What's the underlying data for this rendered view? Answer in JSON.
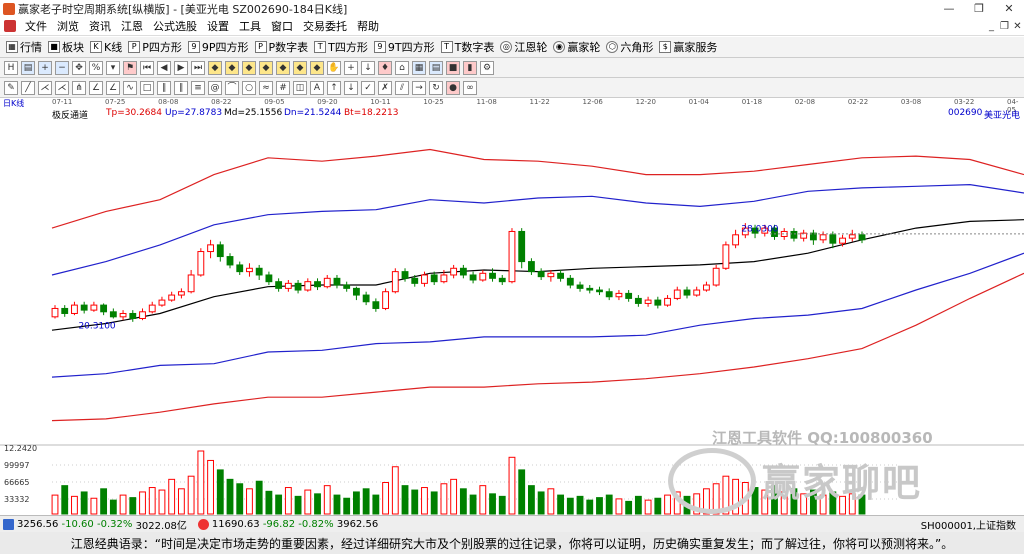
{
  "window": {
    "title": "赢家老子时空周期系统[纵横版] - [美亚光电  SZ002690-184日K线]",
    "controls": [
      "—",
      "❐",
      "✕"
    ]
  },
  "menu": {
    "items": [
      "文件",
      "浏览",
      "资讯",
      "江恩",
      "公式选股",
      "设置",
      "工具",
      "窗口",
      "交易委托",
      "帮助"
    ],
    "right_controls": [
      "_",
      "❐",
      "✕"
    ]
  },
  "toolbar": {
    "items": [
      {
        "label": "行情",
        "icon": "grid-icon"
      },
      {
        "label": "板块",
        "icon": "blocks-icon"
      },
      {
        "label": "K线",
        "icon": "candle-icon"
      },
      {
        "label": "P四方形",
        "icon": "p-square-icon"
      },
      {
        "label": "9P四方形",
        "icon": "9p-square-icon"
      },
      {
        "label": "P数字表",
        "icon": "p-table-icon"
      },
      {
        "label": "T四方形",
        "icon": "t-square-icon"
      },
      {
        "label": "9T四方形",
        "icon": "9t-square-icon"
      },
      {
        "label": "T数字表",
        "icon": "t-table-icon"
      },
      {
        "label": "江恩轮",
        "icon": "gann-wheel-icon"
      },
      {
        "label": "赢家轮",
        "icon": "winner-wheel-icon"
      },
      {
        "label": "六角形",
        "icon": "hexagon-icon"
      },
      {
        "label": "赢家服务",
        "icon": "service-icon"
      }
    ]
  },
  "chart_header": {
    "period": "日K线",
    "indicator_name": "极反通道",
    "tp": "Tp=30.2684",
    "up": "Up=27.8783",
    "md": "Md=25.1556",
    "dn": "Dn=21.5244",
    "bt": "Bt=18.2213",
    "stock_code": "002690",
    "stock_name": "美亚光电"
  },
  "date_ticks": [
    "07-11",
    "07-25",
    "08-08",
    "08-22",
    "09-05",
    "09-20",
    "10-11",
    "10-25",
    "11-08",
    "11-22",
    "12-06",
    "12-20",
    "01-04",
    "01-18",
    "02-08",
    "02-22",
    "03-08",
    "03-22",
    "04-05"
  ],
  "price_labels": {
    "low": "20.3100",
    "high": "28.0300"
  },
  "volume_axis": [
    "12.2420",
    "99997",
    "66665",
    "33332"
  ],
  "watermark": {
    "line1": "江恩工具软件  QQ:100800360",
    "line2": "赢家聊吧"
  },
  "status": {
    "sh": {
      "value": "3256.56",
      "change": "-10.60",
      "pct": "-0.32%",
      "amount": "3022.08亿"
    },
    "sz": {
      "value": "11690.63",
      "change": "-96.82",
      "pct": "-0.82%",
      "amount": "3962.56"
    },
    "right": "SH000001,上证指数"
  },
  "quote": "江恩经典语录：“时间是决定市场走势的重要因素，经过详细研究大市及个别股票的过往记录，你将可以证明，历史确实重复发生；而了解过往，你将可以预测将来。”。",
  "colors": {
    "up": "#ff0000",
    "down": "#008000",
    "red_band": "#dd2222",
    "blue_band": "#2222cc",
    "mid_line": "#000000"
  },
  "chart_data": {
    "type": "line",
    "title": "",
    "xlabel": "",
    "ylabel": "",
    "x": [
      "07-11",
      "07-25",
      "08-08",
      "08-22",
      "09-05",
      "09-20",
      "10-11",
      "10-25",
      "11-08",
      "11-22",
      "12-06",
      "12-20",
      "01-04",
      "01-18",
      "02-08",
      "02-22",
      "03-08",
      "03-22",
      "04-05"
    ],
    "ylim": [
      13.0,
      32.0
    ],
    "series": [
      {
        "name": "Tp",
        "values": [
          25.6,
          26.6,
          27.3,
          28.8,
          29.8,
          29.6,
          29.9,
          30.3,
          29.7,
          29.6,
          29.3,
          28.8,
          28.8,
          29.0,
          29.4,
          29.8,
          29.9,
          29.7,
          28.8
        ]
      },
      {
        "name": "Up",
        "values": [
          22.8,
          23.6,
          24.6,
          25.8,
          26.4,
          26.6,
          26.7,
          27.3,
          27.1,
          27.4,
          27.5,
          27.1,
          26.9,
          27.2,
          27.8,
          28.0,
          28.1,
          28.2,
          27.7
        ]
      },
      {
        "name": "Md",
        "values": [
          19.5,
          19.9,
          20.5,
          21.5,
          22.1,
          22.2,
          22.2,
          22.9,
          23.1,
          23.0,
          23.2,
          23.3,
          23.4,
          23.6,
          24.1,
          24.9,
          25.6,
          26.0,
          26.1
        ]
      },
      {
        "name": "Dn",
        "values": [
          16.7,
          16.9,
          17.4,
          17.5,
          18.2,
          18.3,
          18.7,
          18.8,
          19.1,
          19.1,
          19.1,
          19.2,
          19.8,
          20.2,
          20.4,
          20.8,
          21.9,
          22.9,
          24.1
        ]
      },
      {
        "name": "Bt",
        "values": [
          14.1,
          14.2,
          14.6,
          15.1,
          15.5,
          15.5,
          15.8,
          16.1,
          16.1,
          16.3,
          16.4,
          16.6,
          16.9,
          17.3,
          17.8,
          18.4,
          19.8,
          21.4,
          22.9
        ]
      }
    ],
    "candles": [
      [
        20.3,
        20.8,
        20.2,
        21.0
      ],
      [
        20.8,
        20.5,
        20.3,
        21.0
      ],
      [
        20.5,
        21.0,
        20.4,
        21.2
      ],
      [
        21.0,
        20.7,
        20.5,
        21.2
      ],
      [
        20.7,
        21.0,
        20.6,
        21.2
      ],
      [
        21.0,
        20.6,
        20.4,
        21.1
      ],
      [
        20.6,
        20.3,
        20.2,
        20.8
      ],
      [
        20.3,
        20.5,
        20.1,
        20.7
      ],
      [
        20.5,
        20.2,
        20.0,
        20.7
      ],
      [
        20.2,
        20.6,
        20.1,
        20.8
      ],
      [
        20.6,
        21.0,
        20.5,
        21.2
      ],
      [
        21.0,
        21.3,
        20.9,
        21.5
      ],
      [
        21.3,
        21.6,
        21.2,
        21.8
      ],
      [
        21.6,
        21.8,
        21.4,
        22.0
      ],
      [
        21.8,
        22.8,
        21.7,
        23.1
      ],
      [
        22.8,
        24.2,
        22.7,
        24.4
      ],
      [
        24.2,
        24.6,
        23.8,
        24.9
      ],
      [
        24.6,
        23.9,
        23.6,
        24.8
      ],
      [
        23.9,
        23.4,
        23.2,
        24.1
      ],
      [
        23.4,
        23.0,
        22.8,
        23.6
      ],
      [
        23.0,
        23.2,
        22.7,
        23.5
      ],
      [
        23.2,
        22.8,
        22.5,
        23.4
      ],
      [
        22.8,
        22.4,
        22.2,
        23.0
      ],
      [
        22.4,
        22.0,
        21.8,
        22.6
      ],
      [
        22.0,
        22.3,
        21.8,
        22.5
      ],
      [
        22.3,
        21.9,
        21.7,
        22.5
      ],
      [
        21.9,
        22.4,
        21.8,
        22.6
      ],
      [
        22.4,
        22.1,
        21.9,
        22.6
      ],
      [
        22.1,
        22.6,
        22.0,
        22.8
      ],
      [
        22.6,
        22.2,
        22.0,
        22.8
      ],
      [
        22.2,
        22.0,
        21.8,
        22.4
      ],
      [
        22.0,
        21.6,
        21.3,
        22.1
      ],
      [
        21.6,
        21.2,
        21.0,
        21.8
      ],
      [
        21.2,
        20.8,
        20.6,
        21.4
      ],
      [
        20.8,
        21.8,
        20.7,
        22.0
      ],
      [
        21.8,
        23.0,
        21.7,
        23.2
      ],
      [
        23.0,
        22.6,
        22.4,
        23.2
      ],
      [
        22.6,
        22.3,
        22.1,
        22.8
      ],
      [
        22.3,
        22.8,
        22.1,
        23.0
      ],
      [
        22.8,
        22.4,
        22.2,
        23.0
      ],
      [
        22.4,
        22.8,
        22.3,
        23.1
      ],
      [
        22.8,
        23.2,
        22.6,
        23.4
      ],
      [
        23.2,
        22.8,
        22.6,
        23.4
      ],
      [
        22.8,
        22.5,
        22.3,
        23.0
      ],
      [
        22.5,
        22.9,
        22.4,
        23.1
      ],
      [
        22.9,
        22.6,
        22.4,
        23.2
      ],
      [
        22.6,
        22.4,
        22.2,
        22.8
      ],
      [
        22.4,
        25.4,
        22.3,
        25.6
      ],
      [
        25.4,
        23.6,
        23.2,
        25.6
      ],
      [
        23.6,
        23.0,
        22.8,
        23.8
      ],
      [
        23.0,
        22.7,
        22.5,
        23.2
      ],
      [
        22.7,
        22.9,
        22.4,
        23.1
      ],
      [
        22.9,
        22.6,
        22.4,
        23.1
      ],
      [
        22.6,
        22.2,
        22.0,
        22.8
      ],
      [
        22.2,
        22.0,
        21.8,
        22.4
      ],
      [
        22.0,
        21.9,
        21.7,
        22.2
      ],
      [
        21.9,
        21.8,
        21.6,
        22.1
      ],
      [
        21.8,
        21.5,
        21.3,
        22.0
      ],
      [
        21.5,
        21.7,
        21.3,
        21.9
      ],
      [
        21.7,
        21.4,
        21.2,
        21.9
      ],
      [
        21.4,
        21.1,
        20.9,
        21.6
      ],
      [
        21.1,
        21.3,
        20.9,
        21.5
      ],
      [
        21.3,
        21.0,
        20.8,
        21.5
      ],
      [
        21.0,
        21.4,
        20.9,
        21.6
      ],
      [
        21.4,
        21.9,
        21.3,
        22.1
      ],
      [
        21.9,
        21.6,
        21.4,
        22.1
      ],
      [
        21.6,
        21.9,
        21.5,
        22.1
      ],
      [
        21.9,
        22.2,
        21.8,
        22.4
      ],
      [
        22.2,
        23.2,
        22.1,
        23.4
      ],
      [
        23.2,
        24.6,
        23.1,
        24.8
      ],
      [
        24.6,
        25.2,
        24.4,
        25.5
      ],
      [
        25.2,
        25.6,
        25.0,
        25.9
      ],
      [
        25.6,
        25.3,
        25.0,
        25.8
      ],
      [
        25.3,
        25.6,
        25.1,
        25.8
      ],
      [
        25.6,
        25.1,
        24.9,
        25.8
      ],
      [
        25.1,
        25.4,
        24.9,
        25.6
      ],
      [
        25.4,
        25.0,
        24.8,
        25.6
      ],
      [
        25.0,
        25.3,
        24.8,
        25.5
      ],
      [
        25.3,
        24.9,
        24.6,
        25.5
      ],
      [
        24.9,
        25.2,
        24.7,
        25.4
      ],
      [
        25.2,
        24.7,
        24.4,
        25.4
      ],
      [
        24.7,
        25.0,
        24.5,
        25.2
      ],
      [
        25.0,
        25.2,
        24.8,
        25.5
      ],
      [
        25.2,
        24.9,
        24.7,
        25.4
      ]
    ],
    "volume": [
      30,
      45,
      28,
      35,
      25,
      40,
      22,
      30,
      26,
      35,
      42,
      38,
      55,
      40,
      60,
      100,
      85,
      70,
      55,
      48,
      40,
      52,
      36,
      30,
      42,
      28,
      38,
      32,
      45,
      30,
      25,
      35,
      40,
      30,
      50,
      75,
      45,
      38,
      42,
      35,
      48,
      55,
      40,
      30,
      45,
      32,
      28,
      90,
      70,
      45,
      35,
      40,
      30,
      25,
      28,
      22,
      26,
      30,
      24,
      20,
      28,
      22,
      25,
      30,
      35,
      28,
      32,
      40,
      48,
      60,
      55,
      50,
      42,
      38,
      45,
      35,
      40,
      32,
      38,
      30,
      35,
      28,
      32,
      30
    ]
  }
}
